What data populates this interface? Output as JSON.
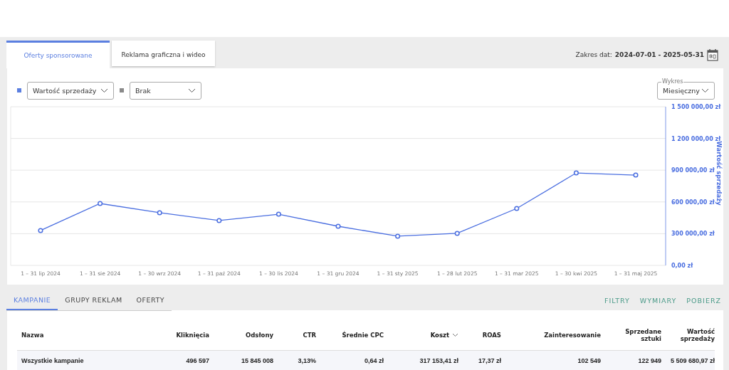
{
  "tabs": [
    {
      "label": "Oferty sponsorowane",
      "selected": true
    },
    {
      "label": "Reklama graficzna i wideo",
      "selected": false
    }
  ],
  "date_range": {
    "label": "Zakres dat:",
    "value": "2024-07-01 - 2025-05-31"
  },
  "controls": {
    "metric_1": {
      "color": "#5b7fe0"
    },
    "metric_2": {
      "color": "#8a8a8a",
      "value": "Brak"
    },
    "chart_mode": {
      "label": "Wykres",
      "value": "Miesięczny"
    }
  },
  "chart_data": {
    "type": "line",
    "grid": true,
    "ylabel": "Wartość sprzedaży",
    "categories": [
      "1 – 31 lip 2024",
      "1 – 31 sie 2024",
      "1 – 30 wrz 2024",
      "1 – 31 paź 2024",
      "1 – 30 lis 2024",
      "1 – 31 gru 2024",
      "1 – 31 sty 2025",
      "1 – 28 lut 2025",
      "1 – 31 mar 2025",
      "1 – 30 kwi 2025",
      "1 – 31 maj 2025"
    ],
    "series": [
      {
        "name": "Wartość sprzedaży",
        "color": "#4a6ee0",
        "marker": "circle",
        "values": [
          330000,
          585000,
          498000,
          424000,
          484000,
          370000,
          276000,
          303000,
          538000,
          874000,
          854000
        ]
      }
    ],
    "ylim": [
      0,
      1500000
    ],
    "yticks": [
      {
        "value": 0,
        "label": "0,00 zł"
      },
      {
        "value": 300000,
        "label": "300 000,00 zł"
      },
      {
        "value": 600000,
        "label": "600 000,00 zł"
      },
      {
        "value": 900000,
        "label": "900 000,00 zł"
      },
      {
        "value": 1200000,
        "label": "1 200 000,00 zł"
      },
      {
        "value": 1500000,
        "label": "1 500 000,00 zł"
      }
    ]
  },
  "table_tabs": [
    {
      "label": "KAMPANIE",
      "selected": true
    },
    {
      "label": "GRUPY REKLAM",
      "selected": false
    },
    {
      "label": "OFERTY",
      "selected": false
    }
  ],
  "table_actions": [
    "FILTRY",
    "WYMIARY",
    "POBIERZ"
  ],
  "table": {
    "columns": [
      {
        "label": "Nazwa",
        "sorted": false
      },
      {
        "label": "Kliknięcia",
        "sorted": false
      },
      {
        "label": "Odsłony",
        "sorted": false
      },
      {
        "label": "CTR",
        "sorted": false
      },
      {
        "label": "Średnie CPC",
        "sorted": false
      },
      {
        "label": "Koszt",
        "sorted": true
      },
      {
        "label": "ROAS",
        "sorted": false
      },
      {
        "label": "Zainteresowanie",
        "sorted": false
      },
      {
        "label": "Sprzedane sztuki",
        "sorted": false
      },
      {
        "label": "Wartość sprzedaży",
        "sorted": false
      }
    ],
    "rows": [
      [
        "Wszystkie kampanie",
        "496 597",
        "15 845 008",
        "3,13%",
        "0,64 zł",
        "317 153,41 zł",
        "17,37 zł",
        "102 549",
        "122 949",
        "5 509 680,97 zł"
      ]
    ]
  }
}
